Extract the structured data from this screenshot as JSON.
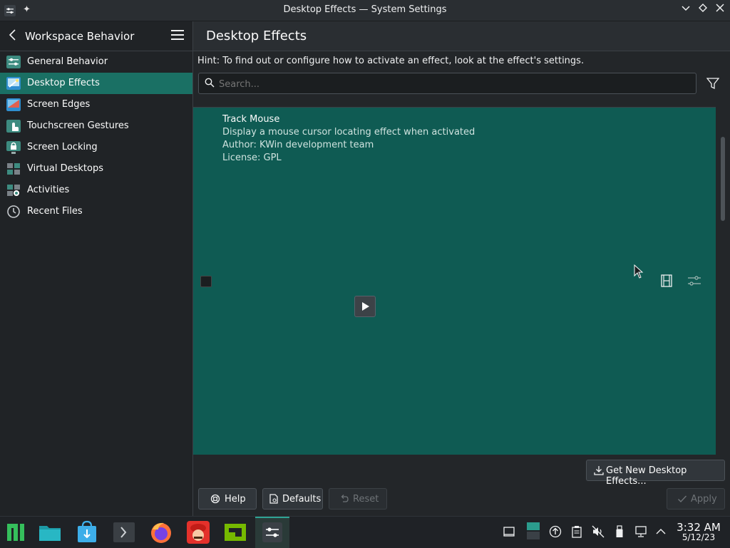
{
  "window": {
    "title": "Desktop Effects — System Settings"
  },
  "sidebar": {
    "header": "Workspace Behavior",
    "items": [
      {
        "label": "General Behavior",
        "icon": "general-behavior-icon",
        "active": false
      },
      {
        "label": "Desktop Effects",
        "icon": "desktop-effects-icon",
        "active": true
      },
      {
        "label": "Screen Edges",
        "icon": "screen-edges-icon",
        "active": false
      },
      {
        "label": "Touchscreen Gestures",
        "icon": "touchscreen-gestures-icon",
        "active": false
      },
      {
        "label": "Screen Locking",
        "icon": "screen-locking-icon",
        "active": false
      },
      {
        "label": "Virtual Desktops",
        "icon": "virtual-desktops-icon",
        "active": false
      },
      {
        "label": "Activities",
        "icon": "activities-icon",
        "active": false
      },
      {
        "label": "Recent Files",
        "icon": "recent-files-icon",
        "active": false
      }
    ]
  },
  "main": {
    "title": "Desktop Effects",
    "hint": "Hint: To find out or configure how to activate an effect, look at the effect's settings.",
    "search_placeholder": "Search...",
    "effect": {
      "name": "Track Mouse",
      "description": "Display a mouse cursor locating effect when activated",
      "author": "Author: KWin development team",
      "license": "License: GPL"
    },
    "buttons": {
      "get_new": "Get New Desktop Effects...",
      "help": "Help",
      "defaults": "Defaults",
      "reset": "Reset",
      "apply": "Apply"
    }
  },
  "taskbar": {
    "time": "3:32 AM",
    "date": "5/12/23"
  },
  "colors": {
    "accent": "#1a7064",
    "selection_bg": "#0f5b53"
  }
}
